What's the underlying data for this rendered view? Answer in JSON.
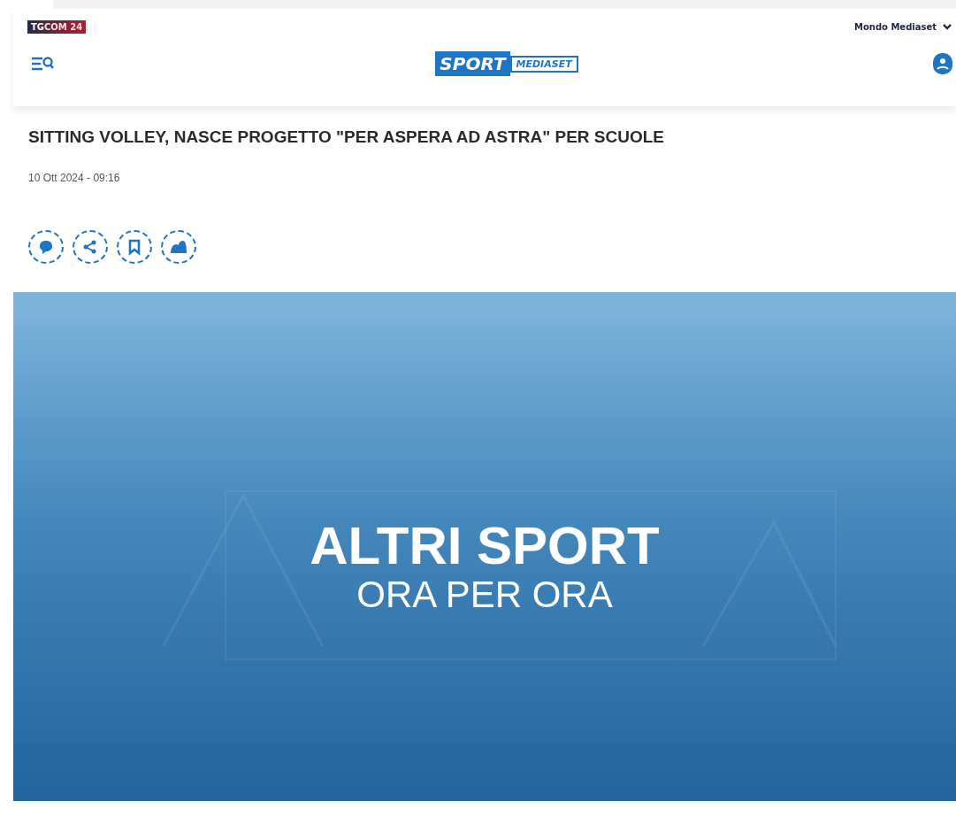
{
  "top_bar": {
    "network_logo": {
      "prefix": "TG",
      "name": "COM 24"
    },
    "network_menu": {
      "label": "Mondo Mediaset",
      "expanded": false
    }
  },
  "header": {
    "brand_logo": {
      "main": "SPORT",
      "sub": "MEDIASET"
    }
  },
  "article": {
    "title": "SITTING VOLLEY, NASCE PROGETTO \"PER ASPERA AD ASTRA\" PER SCUOLE",
    "date": "10 Ott 2024 - 09:16",
    "actions": [
      {
        "kind": "comment"
      },
      {
        "kind": "share"
      },
      {
        "kind": "bookmark"
      },
      {
        "kind": "follow"
      }
    ],
    "cover": {
      "headline": "ALTRI SPORT",
      "subline": "ORA PER ORA"
    }
  }
}
